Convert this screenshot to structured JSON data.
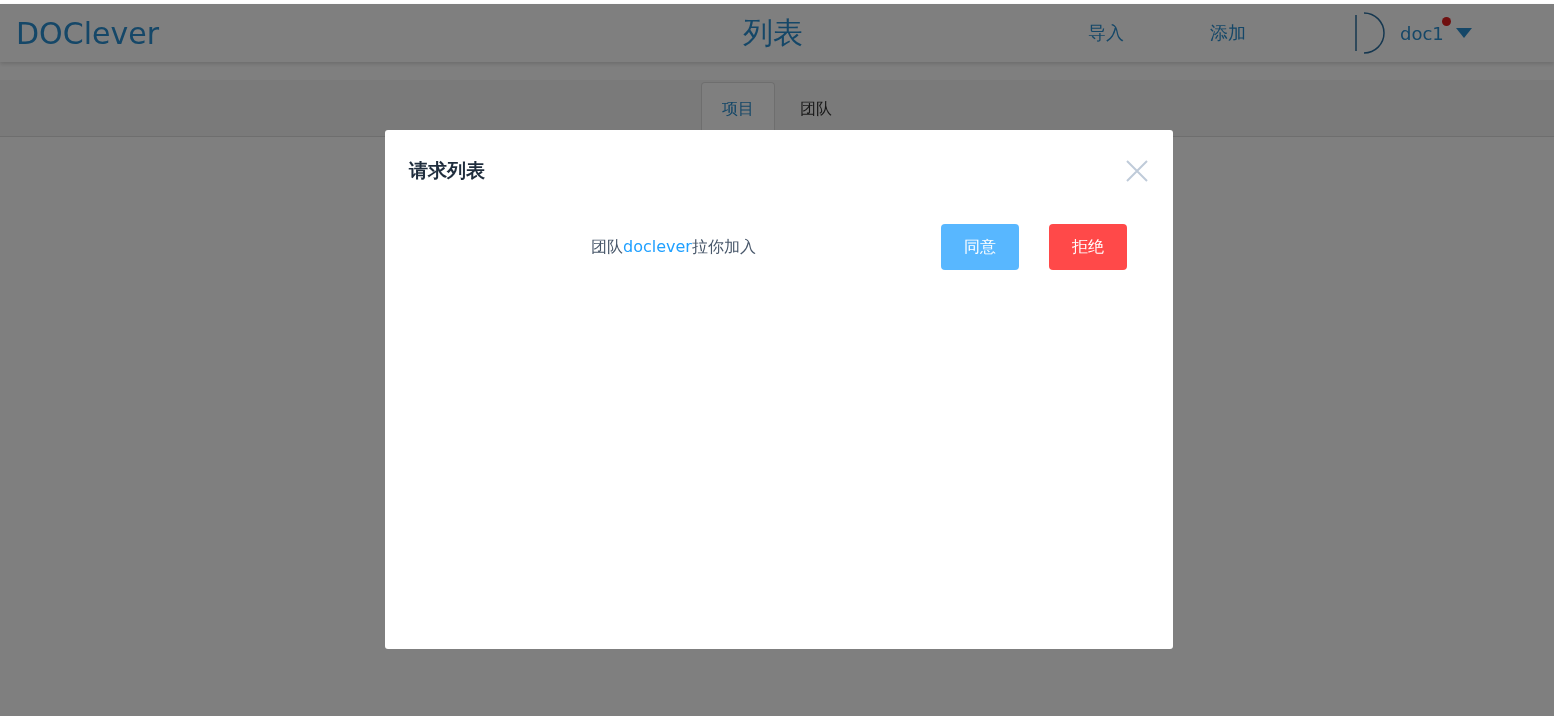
{
  "header": {
    "logo": "DOClever",
    "title": "列表",
    "actions": [
      "导入",
      "添加"
    ],
    "user": {
      "name": "doc1",
      "has_notification": true
    }
  },
  "tabs": [
    {
      "label": "项目",
      "selected": true
    },
    {
      "label": "团队",
      "selected": false
    }
  ],
  "dialog": {
    "title": "请求列表",
    "requests": [
      {
        "prefix": "团队",
        "team": "doclever",
        "suffix": "拉你加入",
        "accept": "同意",
        "reject": "拒绝"
      }
    ]
  }
}
